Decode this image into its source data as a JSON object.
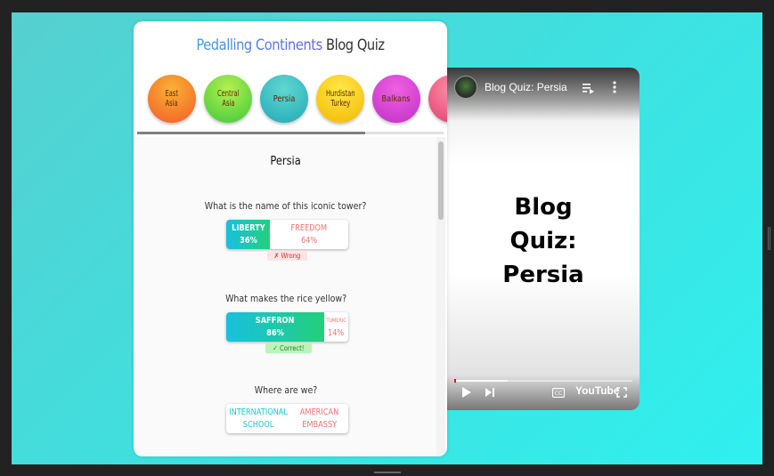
{
  "quiz": {
    "brand": "Pedalling Continents",
    "title_suffix": "Blog Quiz",
    "categories": [
      {
        "label_line1": "East",
        "label_line2": "Asia",
        "color_top": "#f9b233",
        "color_bottom": "#f25c2a"
      },
      {
        "label_line1": "Central",
        "label_line2": "Asia",
        "color_top": "#b8f050",
        "color_bottom": "#3cc83a"
      },
      {
        "label_line1": "Persia",
        "label_line2": "",
        "color_top": "#60d8d0",
        "color_bottom": "#22a8b8"
      },
      {
        "label_line1": "Hurdistan",
        "label_line2": "Turkey",
        "color_top": "#ffe84a",
        "color_bottom": "#f2b800"
      },
      {
        "label_line1": "Balkans",
        "label_line2": "",
        "color_top": "#f060e0",
        "color_bottom": "#c030c8"
      },
      {
        "label_line1": "",
        "label_line2": "",
        "color_top": "#ff8fa8",
        "color_bottom": "#e04070"
      }
    ],
    "section_title": "Persia",
    "questions": [
      {
        "text": "What is the name of this iconic tower?",
        "answers": [
          {
            "label": "LIBERTY",
            "percent": "36%",
            "selected": true
          },
          {
            "label": "FREEDOM",
            "percent": "64%",
            "selected": false
          }
        ],
        "feedback": "✗ Wrong"
      },
      {
        "text": "What makes the rice yellow?",
        "answers": [
          {
            "label": "SAFFRON",
            "percent": "86%",
            "selected": true
          },
          {
            "label": "TUMERIC",
            "percent": "14%",
            "selected": false
          }
        ],
        "feedback": "✓ Correct!"
      },
      {
        "text": "Where are we?",
        "answers": [
          {
            "label_line1": "INTERNATIONAL",
            "label_line2": "SCHOOL"
          },
          {
            "label_line1": "AMERICAN",
            "label_line2": "EMBASSY"
          }
        ]
      }
    ]
  },
  "video": {
    "title": "Blog Quiz: Persia",
    "thumbnail_text_line1": "Blog",
    "thumbnail_text_line2": "Quiz:",
    "thumbnail_text_line3": "Persia",
    "logo": "YouTube",
    "progress": {
      "played_fraction": 0.01,
      "buffered_fraction": 0.3
    },
    "icons": [
      "channel-avatar",
      "queue-icon",
      "more-icon",
      "play-icon",
      "next-icon",
      "captions-icon",
      "fullscreen-icon"
    ]
  }
}
